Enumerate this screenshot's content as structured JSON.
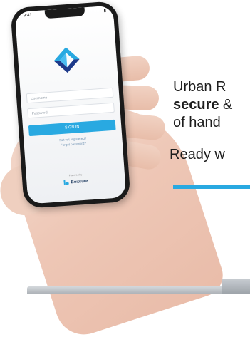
{
  "phone": {
    "status_time": "9:41",
    "username_placeholder": "Username",
    "password_placeholder": "Password",
    "signin_label": "SIGN IN",
    "register_link": "Not yet registered?",
    "forgot_link": "Forgot password?",
    "powered_by": "Powered by",
    "brand_name": "Beitsure",
    "accent_color": "#29a9e1",
    "logo_colors": [
      "#29a9e1",
      "#1e3a8a"
    ]
  },
  "marketing": {
    "line1": "Urban R",
    "line2_bold": "secure",
    "line2_rest": " &",
    "line3": "of hand",
    "ready": "Ready w"
  }
}
